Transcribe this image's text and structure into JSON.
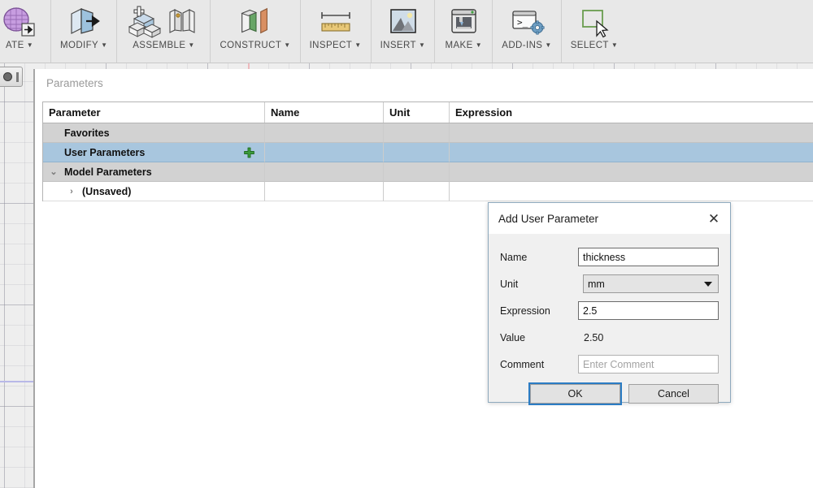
{
  "toolbar": {
    "groups": [
      {
        "label": "ATE",
        "icon": "create-mesh-icon",
        "has_caret": true,
        "truncated": true
      },
      {
        "label": "MODIFY",
        "icon": "modify-box-arrow-icon",
        "has_caret": true
      },
      {
        "label": "ASSEMBLE",
        "icon": "assemble-blocks-icon",
        "has_caret": true
      },
      {
        "label": "CONSTRUCT",
        "icon": "construct-planes-icon",
        "has_caret": true
      },
      {
        "label": "INSPECT",
        "icon": "ruler-measure-icon",
        "has_caret": true
      },
      {
        "label": "INSERT",
        "icon": "image-mountain-icon",
        "has_caret": true
      },
      {
        "label": "MAKE",
        "icon": "3d-printer-icon",
        "has_caret": true
      },
      {
        "label": "ADD-INS",
        "icon": "script-gear-icon",
        "has_caret": true
      },
      {
        "label": "SELECT",
        "icon": "select-cursor-icon",
        "has_caret": true
      }
    ]
  },
  "panel": {
    "title": "Parameters"
  },
  "table": {
    "columns": [
      "Parameter",
      "Name",
      "Unit",
      "Expression"
    ],
    "rows": [
      {
        "parameter": "Favorites",
        "name": "",
        "unit": "",
        "expression": "",
        "indent": 1,
        "style": "group",
        "chevron": "",
        "has_add": false
      },
      {
        "parameter": "User Parameters",
        "name": "",
        "unit": "",
        "expression": "",
        "indent": 1,
        "style": "selected",
        "chevron": "",
        "has_add": true
      },
      {
        "parameter": "Model Parameters",
        "name": "",
        "unit": "",
        "expression": "",
        "indent": 1,
        "style": "group",
        "chevron": "open",
        "has_add": false
      },
      {
        "parameter": "(Unsaved)",
        "name": "",
        "unit": "",
        "expression": "",
        "indent": 2,
        "style": "child",
        "chevron": "closed",
        "has_add": false
      }
    ]
  },
  "dialog": {
    "title": "Add User Parameter",
    "close_label": "✕",
    "fields": {
      "name_label": "Name",
      "name_value": "thickness",
      "unit_label": "Unit",
      "unit_value": "mm",
      "expression_label": "Expression",
      "expression_value": "2.5",
      "value_label": "Value",
      "value_readout": "2.50",
      "comment_label": "Comment",
      "comment_value": "",
      "comment_placeholder": "Enter Comment"
    },
    "buttons": {
      "ok": "OK",
      "cancel": "Cancel"
    }
  },
  "colors": {
    "selection_blue": "#a8c6de",
    "group_gray": "#d2d2d2",
    "focus_blue": "#2b7cc4",
    "add_green": "#3c9b3c",
    "axis_x": "#b8b8e8",
    "axis_y": "#edb9bd"
  }
}
